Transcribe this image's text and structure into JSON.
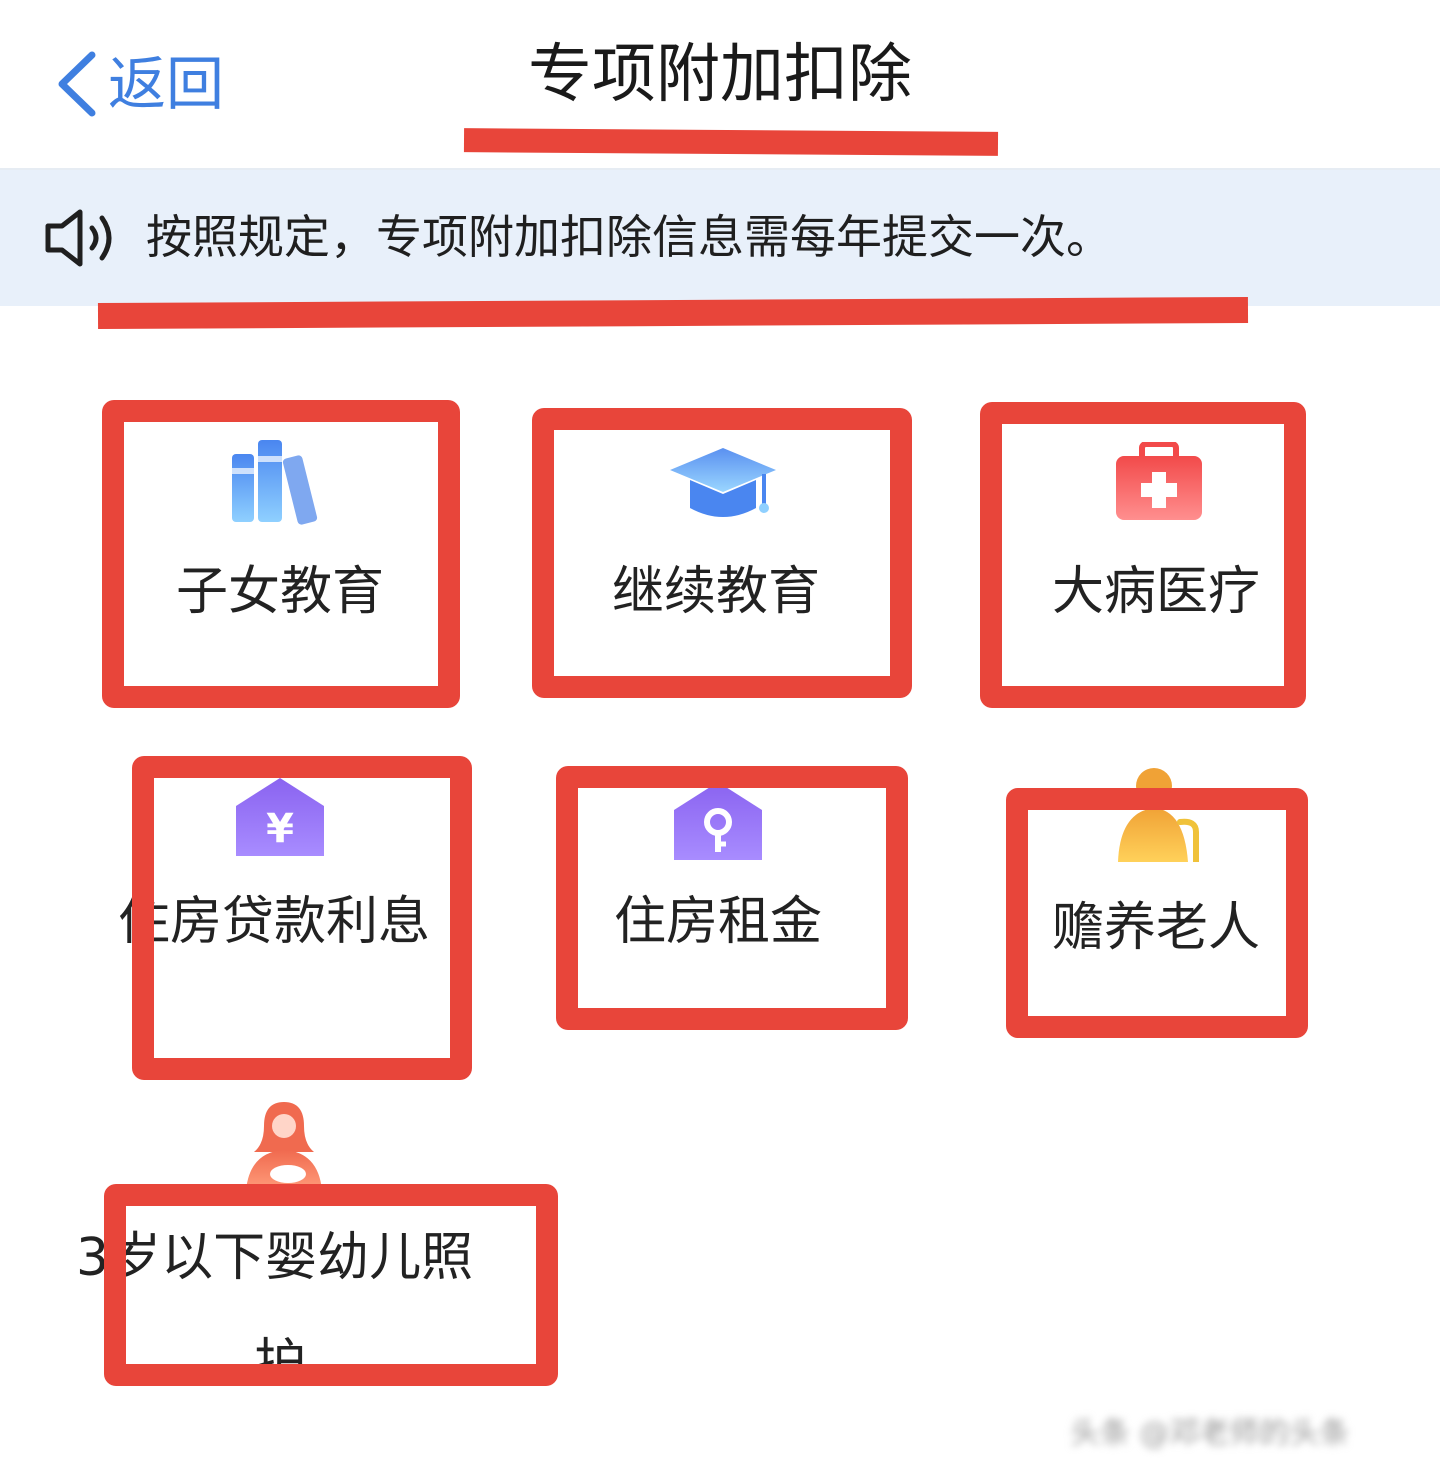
{
  "header": {
    "back_label": "返回",
    "title": "专项附加扣除"
  },
  "notice": {
    "text": "按照规定，专项附加扣除信息需每年提交一次。"
  },
  "categories": [
    {
      "label": "子女教育",
      "icon": "books-icon"
    },
    {
      "label": "继续教育",
      "icon": "graduation-cap-icon"
    },
    {
      "label": "大病医疗",
      "icon": "medical-kit-icon"
    },
    {
      "label": "住房贷款利息",
      "icon": "house-yen-icon"
    },
    {
      "label": "住房租金",
      "icon": "house-key-icon"
    },
    {
      "label": "赡养老人",
      "icon": "elderly-person-icon"
    },
    {
      "label": "3岁以下婴幼儿照",
      "label_line2": "护",
      "icon": "mother-baby-icon"
    }
  ],
  "watermark": "头条 @邓老师的头条",
  "colors": {
    "accent_blue": "#3f7fe0",
    "annotation_red": "#e8453a",
    "notice_bg": "#e8f0fa"
  }
}
